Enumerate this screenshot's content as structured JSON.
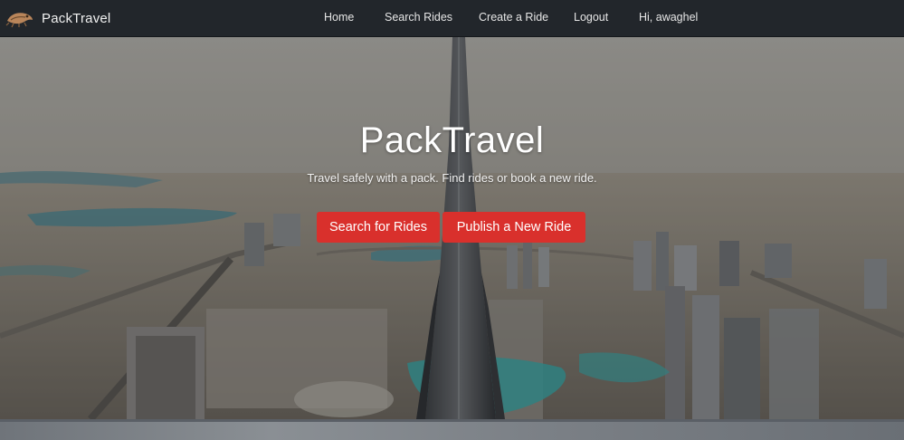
{
  "navbar": {
    "brand": "PackTravel",
    "links": {
      "home": "Home",
      "search_rides": "Search Rides",
      "create_ride": "Create a Ride",
      "logout": "Logout",
      "greeting": "Hi, awaghel"
    }
  },
  "hero": {
    "title": "PackTravel",
    "subtitle": "Travel safely with a pack. Find rides or book a new ride.",
    "buttons": {
      "search": "Search for Rides",
      "publish": "Publish a New Ride"
    }
  },
  "colors": {
    "navbar_bg": "#22262b",
    "button_red": "#d9302c"
  },
  "icons": {
    "brand_logo": "packtravel-logo-icon"
  }
}
